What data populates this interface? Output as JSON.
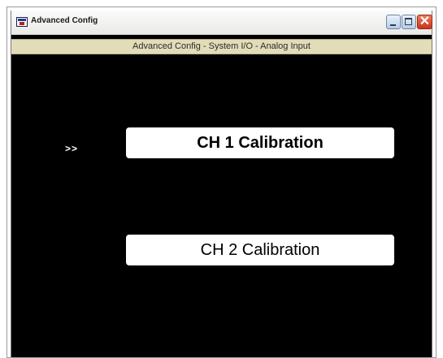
{
  "window": {
    "title": "Advanced Config",
    "close_glyph": "✕"
  },
  "subtitle": "Advanced Config - System I/O - Analog Input",
  "menu": {
    "selection_marker": ">>",
    "items": [
      {
        "label": "CH 1 Calibration",
        "selected": true
      },
      {
        "label": "CH 2 Calibration",
        "selected": false
      }
    ]
  },
  "colors": {
    "background": "#000000",
    "subtitle_bar": "#e3dcb8",
    "button": "#ffffff",
    "close_button": "#d9492a"
  },
  "icons": {
    "app": "app-window-icon",
    "minimize": "minimize-icon",
    "maximize": "maximize-icon",
    "close": "close-icon"
  }
}
